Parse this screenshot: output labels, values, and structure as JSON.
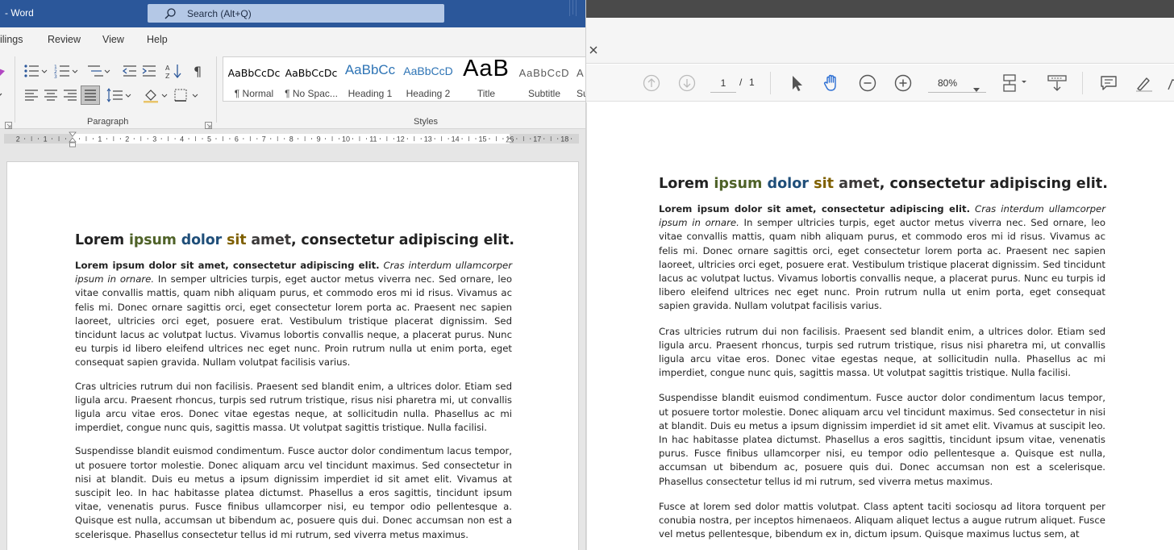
{
  "word": {
    "title": "- Word",
    "search_placeholder": "Search (Alt+Q)",
    "tabs": [
      "ilings",
      "Review",
      "View",
      "Help"
    ],
    "groups": {
      "paragraph": "Paragraph",
      "styles": "Styles"
    },
    "styles": [
      {
        "sample": "AaBbCcDc",
        "name": "¶ Normal"
      },
      {
        "sample": "AaBbCcDc",
        "name": "¶ No Spac..."
      },
      {
        "sample": "AaBbCc",
        "name": "Heading 1"
      },
      {
        "sample": "AaBbCcD",
        "name": "Heading 2"
      },
      {
        "sample": "AaB",
        "name": "Title"
      },
      {
        "sample": "AaBbCcD",
        "name": "Subtitle"
      },
      {
        "sample": "A",
        "name": "Su"
      }
    ],
    "ruler_numbers": [
      "2",
      "1",
      "1",
      "2",
      "3",
      "4",
      "5",
      "6",
      "7",
      "8",
      "9",
      "10",
      "11",
      "12",
      "13",
      "14",
      "15",
      "16",
      "17",
      "18"
    ]
  },
  "pdf": {
    "page_current": "1",
    "page_sep": "/",
    "page_total": "1",
    "zoom": "80%"
  },
  "doc": {
    "title_parts": [
      "Lorem ",
      "ipsum",
      " ",
      "dolor",
      " ",
      "sit",
      " ",
      "amet",
      ", consectetur adipiscing elit."
    ],
    "p1_bold": "Lorem ipsum dolor sit amet, consectetur adipiscing elit.",
    "p1_italic": "Cras interdum ullamcorper ipsum in ornare.",
    "p1_rest": "In semper ultricies turpis, eget auctor metus viverra nec. Sed ornare, leo vitae convallis mattis, quam nibh aliquam purus, et commodo eros mi id risus. Vivamus ac felis mi. Donec ornare sagittis orci, eget consectetur lorem porta ac. Praesent nec sapien laoreet, ultricies orci eget, posuere erat. Vestibulum tristique placerat dignissim. Sed tincidunt lacus ac volutpat luctus. Vivamus lobortis convallis neque, a placerat purus. Nunc eu turpis id libero eleifend ultrices nec eget nunc. Proin rutrum nulla ut enim porta, eget consequat sapien gravida. Nullam volutpat facilisis varius.",
    "p2": "Cras ultricies rutrum dui non facilisis. Praesent sed blandit enim, a ultrices dolor. Etiam sed ligula arcu. Praesent rhoncus, turpis sed rutrum tristique, risus nisi pharetra mi, ut convallis ligula arcu vitae eros. Donec vitae egestas neque, at sollicitudin nulla. Phasellus ac mi imperdiet, congue nunc quis, sagittis massa. Ut volutpat sagittis tristique. Nulla facilisi.",
    "p3": "Suspendisse blandit euismod condimentum. Fusce auctor dolor condimentum lacus tempor, ut posuere tortor molestie. Donec aliquam arcu vel tincidunt maximus. Sed consectetur in nisi at blandit. Duis eu metus a ipsum dignissim imperdiet id sit amet elit. Vivamus at suscipit leo. In hac habitasse platea dictumst. Phasellus a eros sagittis, tincidunt ipsum vitae, venenatis purus. Fusce finibus ullamcorper nisi, eu tempor odio pellentesque a. Quisque est nulla, accumsan ut bibendum ac, posuere quis dui. Donec accumsan non est a scelerisque. Phasellus consectetur tellus id mi rutrum, sed viverra metus maximus.",
    "p4": "Fusce at lorem sed dolor mattis volutpat. Class aptent taciti sociosqu ad litora torquent per conubia nostra, per inceptos himenaeos. Aliquam aliquet lectus a augue rutrum aliquet. Fusce vel metus pellentesque, bibendum ex in, dictum ipsum. Quisque maximus luctus sem, at"
  },
  "colors": {
    "word_blue": "#2b579a",
    "title_ipsum": "#4f6228",
    "title_dolor": "#1f4e79",
    "title_sit": "#7f6000",
    "title_amet": "#3b3838",
    "pdf_hand_active": "#2d6fd3"
  },
  "icons": {
    "word": [
      "search-icon",
      "bullets-icon",
      "numbering-icon",
      "multilevel-list-icon",
      "decrease-indent-icon",
      "increase-indent-icon",
      "sort-icon",
      "show-formatting-icon",
      "align-left-icon",
      "align-center-icon",
      "align-right-icon",
      "justify-icon",
      "line-spacing-icon",
      "shading-icon",
      "borders-icon"
    ],
    "pdf": [
      "close-icon",
      "prev-page-icon",
      "next-page-icon",
      "select-tool-icon",
      "hand-tool-icon",
      "zoom-out-icon",
      "zoom-in-icon",
      "page-fit-icon",
      "scroll-mode-icon",
      "comment-icon",
      "highlight-icon"
    ]
  }
}
